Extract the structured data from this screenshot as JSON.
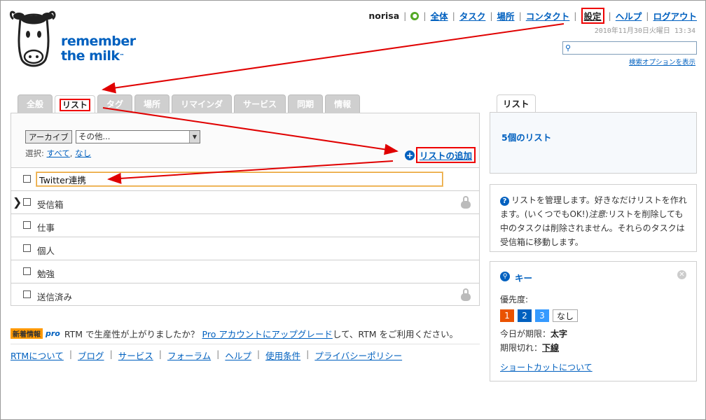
{
  "logo": {
    "line1": "remember",
    "line2": "the milk",
    "tm": "™"
  },
  "topnav": {
    "user": "norisa",
    "links": [
      "全体",
      "タスク",
      "場所",
      "コンタクト",
      "設定",
      "ヘルプ",
      "ログアウト"
    ],
    "datetime": "2010年11月30日火曜日 13:34",
    "search_placeholder": "",
    "search_options": "検索オプションを表示"
  },
  "tabs": [
    "全般",
    "リスト",
    "タグ",
    "場所",
    "リマインダ",
    "サービス",
    "同期",
    "情報"
  ],
  "panel": {
    "archive_button": "アーカイブ",
    "select_value": "その他...",
    "select_prefix": "選択:",
    "select_all": "すべて",
    "select_sep": ",",
    "select_none": "なし",
    "add_list": "リストの追加",
    "edit_value": "Twitter連携",
    "lists": [
      {
        "name": "受信箱",
        "locked": true,
        "current": true
      },
      {
        "name": "仕事",
        "locked": false
      },
      {
        "name": "個人",
        "locked": false
      },
      {
        "name": "勉強",
        "locked": false
      },
      {
        "name": "送信済み",
        "locked": true
      }
    ]
  },
  "promo": {
    "badge_new": "新着情報",
    "badge_pro": "pro",
    "text_before": "RTM で生産性が上がりましたか？",
    "link": "Pro アカウントにアップグレード",
    "text_after": "して、RTM をご利用ください。"
  },
  "footer": [
    "RTMについて",
    "ブログ",
    "サービス",
    "フォーラム",
    "ヘルプ",
    "使用条件",
    "プライバシーポリシー"
  ],
  "sidebar": {
    "tab": "リスト",
    "count": "5個のリスト",
    "help_text_1": "リストを管理します。好きなだけリストを作れます。(いくつでもOK!)",
    "help_note": "注意:",
    "help_text_2": "リストを削除しても中のタスクは削除されません。それらのタスクは受信箱に移動します。",
    "key_title": "キー",
    "priority_label": "優先度:",
    "priorities": [
      "1",
      "2",
      "3",
      "なし"
    ],
    "due_today_label": "今日が期限：",
    "due_today_value": "太字",
    "overdue_label": "期限切れ：",
    "overdue_value": "下線",
    "shortcuts_link": "ショートカットについて"
  },
  "colors": {
    "accent": "#0060bf",
    "annotation": "#e00000",
    "priority1": "#ea5200",
    "priority2": "#0060bf",
    "priority3": "#359aff"
  }
}
